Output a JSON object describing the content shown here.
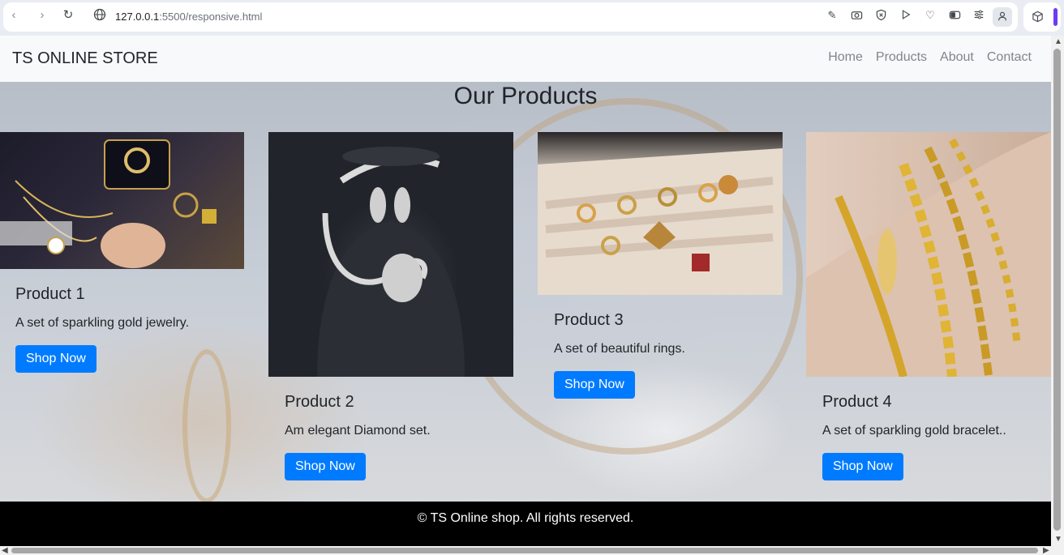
{
  "browser": {
    "url_host": "127.0.0.1",
    "url_path": ":5500/responsive.html"
  },
  "navbar": {
    "brand": "TS ONLINE STORE",
    "links": [
      "Home",
      "Products",
      "About",
      "Contact"
    ]
  },
  "main": {
    "heading": "Our Products",
    "products": [
      {
        "title": "Product 1",
        "description": "A set of sparkling gold jewelry.",
        "button": "Shop Now"
      },
      {
        "title": "Product 2",
        "description": "Am elegant Diamond set.",
        "button": "Shop Now"
      },
      {
        "title": "Product 3",
        "description": "A set of beautiful rings.",
        "button": "Shop Now"
      },
      {
        "title": "Product 4",
        "description": "A set of sparkling gold bracelet..",
        "button": "Shop Now"
      }
    ]
  },
  "footer": {
    "text": "© TS Online shop. All rights reserved."
  },
  "colors": {
    "primary_button": "#007bff",
    "navbar_bg": "#f8f9fa",
    "footer_bg": "#000000"
  },
  "icons": [
    "back-icon",
    "forward-icon",
    "reload-icon",
    "site-info-icon",
    "edit-icon",
    "camera-icon",
    "shield-icon",
    "play-icon",
    "heart-icon",
    "toggle-icon",
    "sliders-icon",
    "profile-icon",
    "extensions-icon"
  ]
}
